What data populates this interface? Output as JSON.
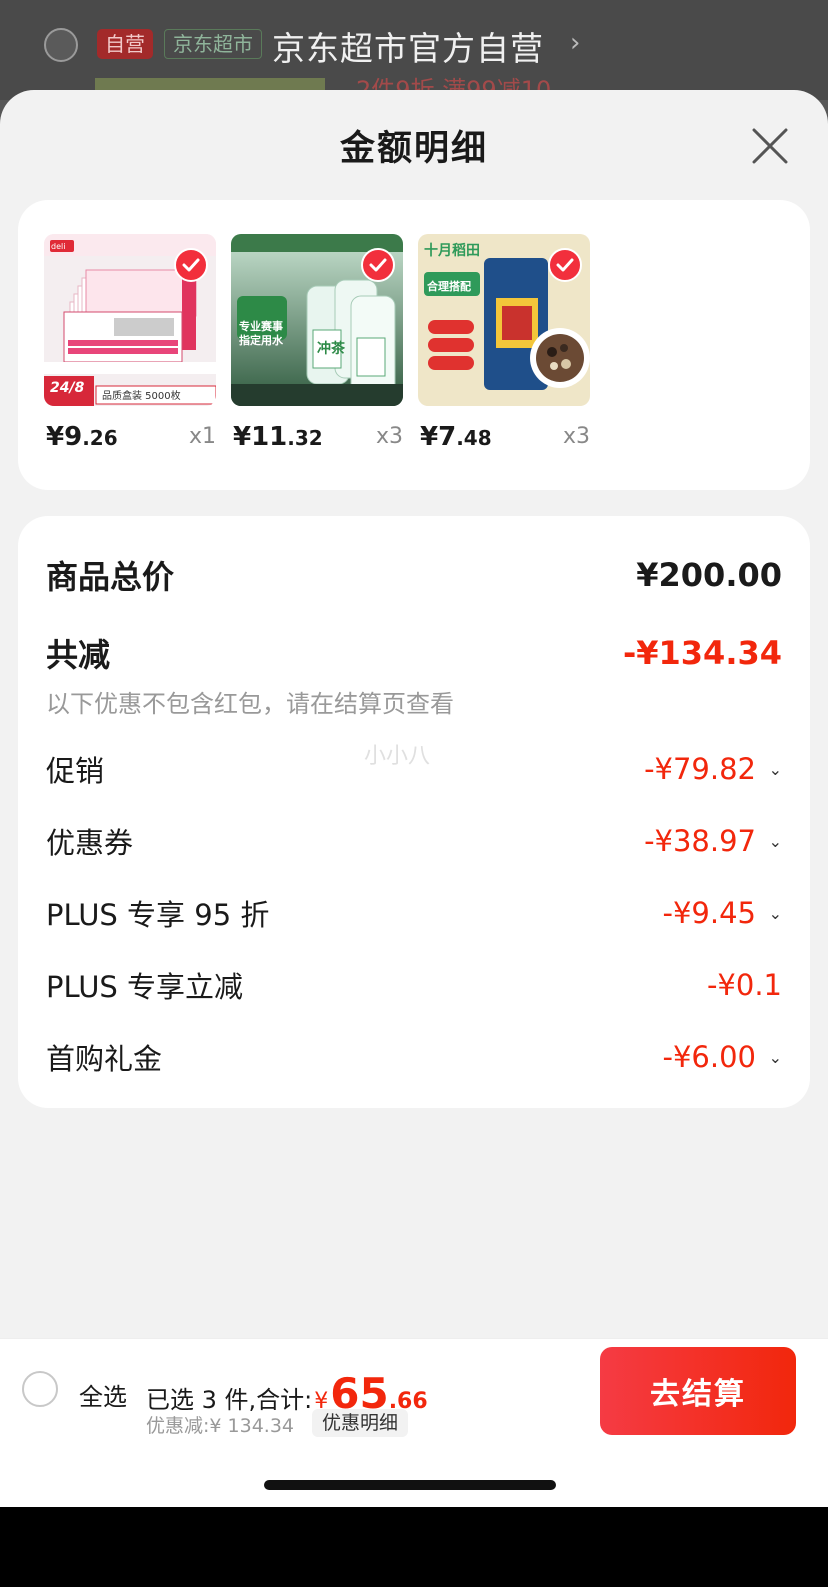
{
  "background": {
    "tag_self": "自营",
    "tag_jd": "京东超市",
    "store_name": "京东超市官方自营",
    "promo_text": "2件9折  满99减10"
  },
  "sheet": {
    "title": "金额明细"
  },
  "products": [
    {
      "price_int": "¥9",
      "price_dec": ".26",
      "qty": "x1",
      "img_caption": "品质盒装 5000枚",
      "img_badge": "24/8",
      "brand": "deli"
    },
    {
      "price_int": "¥11",
      "price_dec": ".32",
      "qty": "x3",
      "img_caption": "专业赛事 指定用水",
      "img_badge": "冲茶",
      "brand": ""
    },
    {
      "price_int": "¥7",
      "price_dec": ".48",
      "qty": "x3",
      "img_caption": "十月稻田",
      "img_badge": "合理搭配",
      "brand": ""
    }
  ],
  "summary": {
    "total_label": "商品总价",
    "total_value": "¥200.00",
    "reduce_label": "共减",
    "reduce_value": "-¥134.34",
    "note": "以下优惠不包含红包，请在结算页查看",
    "watermark": "小小八",
    "items": [
      {
        "label": "促销",
        "value": "-¥79.82",
        "chevron": true
      },
      {
        "label": "优惠券",
        "value": "-¥38.97",
        "chevron": true
      },
      {
        "label": "PLUS 专享 95 折",
        "value": "-¥9.45",
        "chevron": true
      },
      {
        "label": "PLUS 专享立减",
        "value": "-¥0.1",
        "chevron": false
      },
      {
        "label": "首购礼金",
        "value": "-¥6.00",
        "chevron": true
      }
    ]
  },
  "bottom_bar": {
    "select_all": "全选",
    "selected_text": "已选 3 件,合计:",
    "currency": "¥",
    "total_int": "65",
    "total_dec": ".66",
    "discount_text": "优惠减:¥ 134.34",
    "detail_button": "优惠明细",
    "checkout_button": "去结算"
  },
  "colors": {
    "accent_red": "#f2270c",
    "button_red": "#f53b44",
    "sheet_bg": "#f2f2f2"
  }
}
